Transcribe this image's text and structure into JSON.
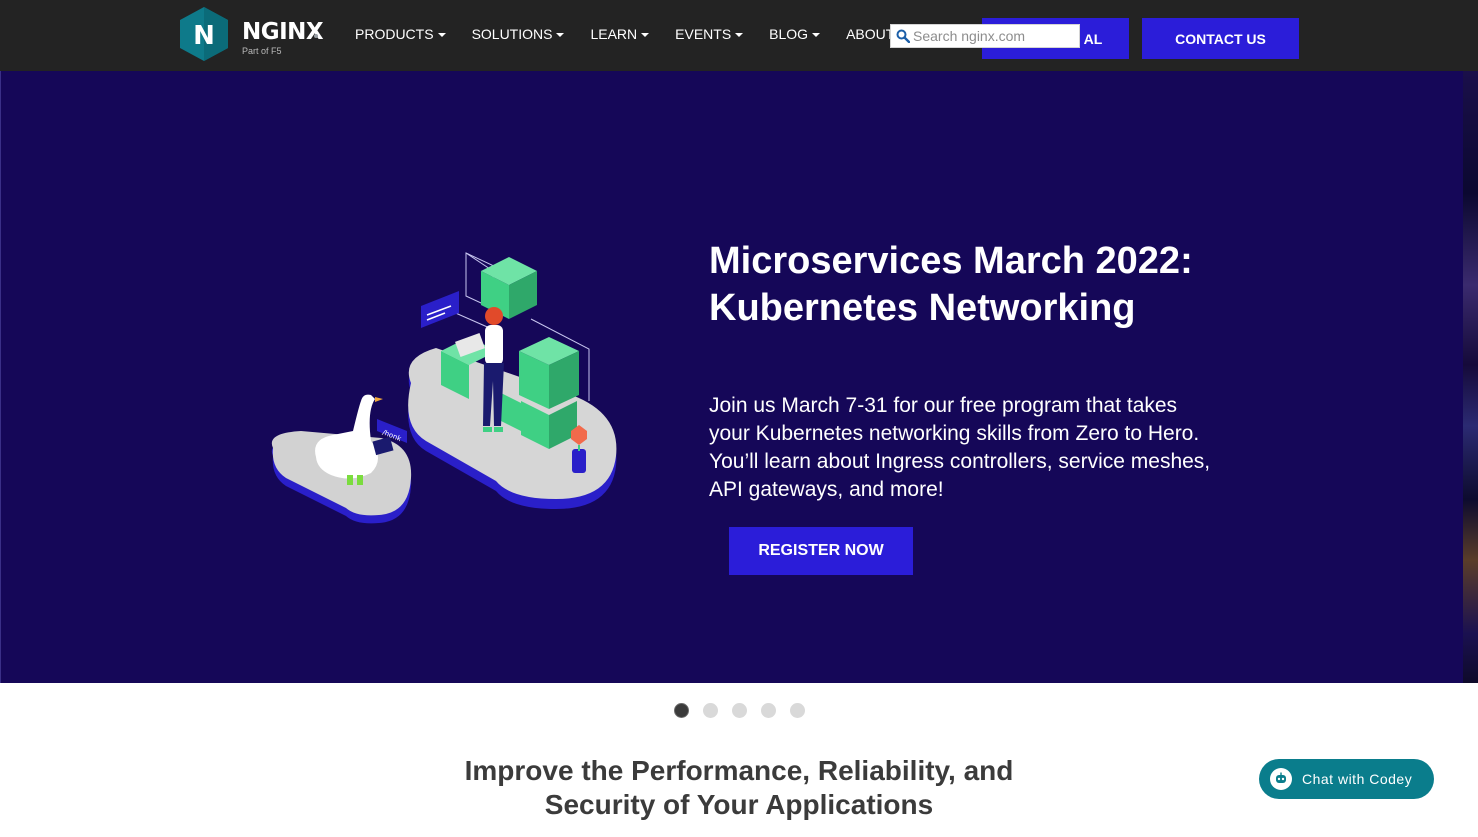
{
  "header": {
    "logo": {
      "wordmark": "NGINX",
      "subtitle": "Part of F5",
      "letter": "N"
    },
    "nav": [
      {
        "label": "PRODUCTS"
      },
      {
        "label": "SOLUTIONS"
      },
      {
        "label": "LEARN"
      },
      {
        "label": "EVENTS"
      },
      {
        "label": "BLOG"
      },
      {
        "label": "ABOUT"
      }
    ],
    "search": {
      "placeholder": "Search nginx.com",
      "icon": "search-icon"
    },
    "free_trial_label_visible": "AL",
    "contact_label": "CONTACT US"
  },
  "hero": {
    "title_line1": "Microservices March 2022:",
    "title_line2": "Kubernetes Networking",
    "description": "Join us March 7-31 for our free program that takes your Kubernetes networking skills from Zero to Hero. You’ll learn about Ingress controllers, service meshes, API gateways, and more!",
    "cta_label": "REGISTER NOW",
    "carousel": {
      "slide_count": 5,
      "active_index": 0
    },
    "illustration": {
      "goose_sign": "/honk"
    }
  },
  "tagline": {
    "line1": "Improve the Performance, Reliability, and",
    "line2": "Security of Your Applications"
  },
  "chat": {
    "label": "Chat with Codey",
    "icon": "chatbot-icon"
  },
  "colors": {
    "header_bg": "#232323",
    "hero_bg": "#150758",
    "accent_blue": "#2b1dd9",
    "logo_teal": "#0e7a8a",
    "chat_teal": "#0a7d8c",
    "cube_green": "#3fd084"
  }
}
